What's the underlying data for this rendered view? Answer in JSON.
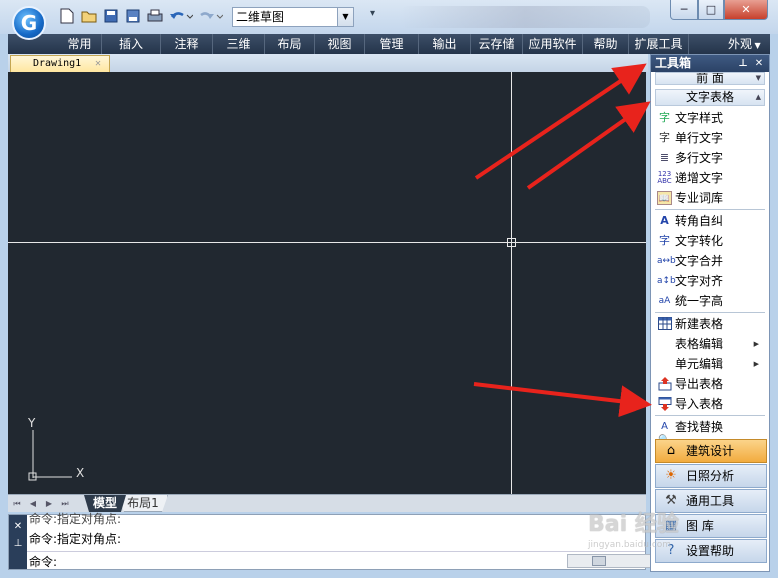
{
  "app": {
    "logo_letter": "G"
  },
  "quick_toolbar": {
    "icons": [
      "new-file-icon",
      "open-folder-icon",
      "save-icon",
      "save-as-icon",
      "print-icon",
      "undo-icon",
      "redo-icon"
    ],
    "workspace": "二维草图"
  },
  "window_buttons": {
    "minimize": "─",
    "maximize": "□",
    "close": "✕"
  },
  "menu": {
    "items": [
      "常用",
      "插入",
      "注释",
      "三维",
      "布局",
      "视图",
      "管理",
      "输出",
      "云存储",
      "应用软件",
      "帮助",
      "扩展工具"
    ],
    "appearance": "外观"
  },
  "document_tab": {
    "label": "Drawing1"
  },
  "layout_tabs": {
    "model": "模型",
    "layout1": "布局1"
  },
  "command": {
    "line1": "命令:指定对角点:",
    "line2": "命令:指定对角点:",
    "prompt": "命令:"
  },
  "toolbox": {
    "title": "工具箱",
    "category_collapsed": "前      面",
    "category_open": "文字表格",
    "tools": [
      {
        "label": "文字样式",
        "icon": "text-style-icon"
      },
      {
        "label": "单行文字",
        "icon": "single-line-text-icon"
      },
      {
        "label": "多行文字",
        "icon": "multiline-text-icon"
      },
      {
        "label": "递增文字",
        "icon": "increment-text-icon"
      },
      {
        "label": "专业词库",
        "icon": "dictionary-icon"
      },
      {
        "label": "转角自纠",
        "icon": "angle-correct-icon"
      },
      {
        "label": "文字转化",
        "icon": "text-convert-icon"
      },
      {
        "label": "文字合并",
        "icon": "text-merge-icon"
      },
      {
        "label": "文字对齐",
        "icon": "text-align-icon"
      },
      {
        "label": "统一字高",
        "icon": "text-height-icon"
      },
      {
        "label": "新建表格",
        "icon": "new-table-icon"
      },
      {
        "label": "表格编辑",
        "icon": ""
      },
      {
        "label": "单元编辑",
        "icon": ""
      },
      {
        "label": "导出表格",
        "icon": "export-table-icon"
      },
      {
        "label": "导入表格",
        "icon": "import-table-icon"
      },
      {
        "label": "查找替换",
        "icon": "find-replace-icon"
      }
    ],
    "big_buttons": [
      {
        "label": "建筑设计",
        "icon": "house-icon"
      },
      {
        "label": "日照分析",
        "icon": "sun-icon"
      },
      {
        "label": "通用工具",
        "icon": "tools-icon"
      },
      {
        "label": "图    库",
        "icon": "gallery-icon"
      },
      {
        "label": "设置帮助",
        "icon": "help-icon"
      }
    ]
  },
  "axes": {
    "y": "Y",
    "x": "X"
  },
  "watermark": {
    "text": "Bai  经验",
    "sub": "jingyan.baidu.com"
  }
}
